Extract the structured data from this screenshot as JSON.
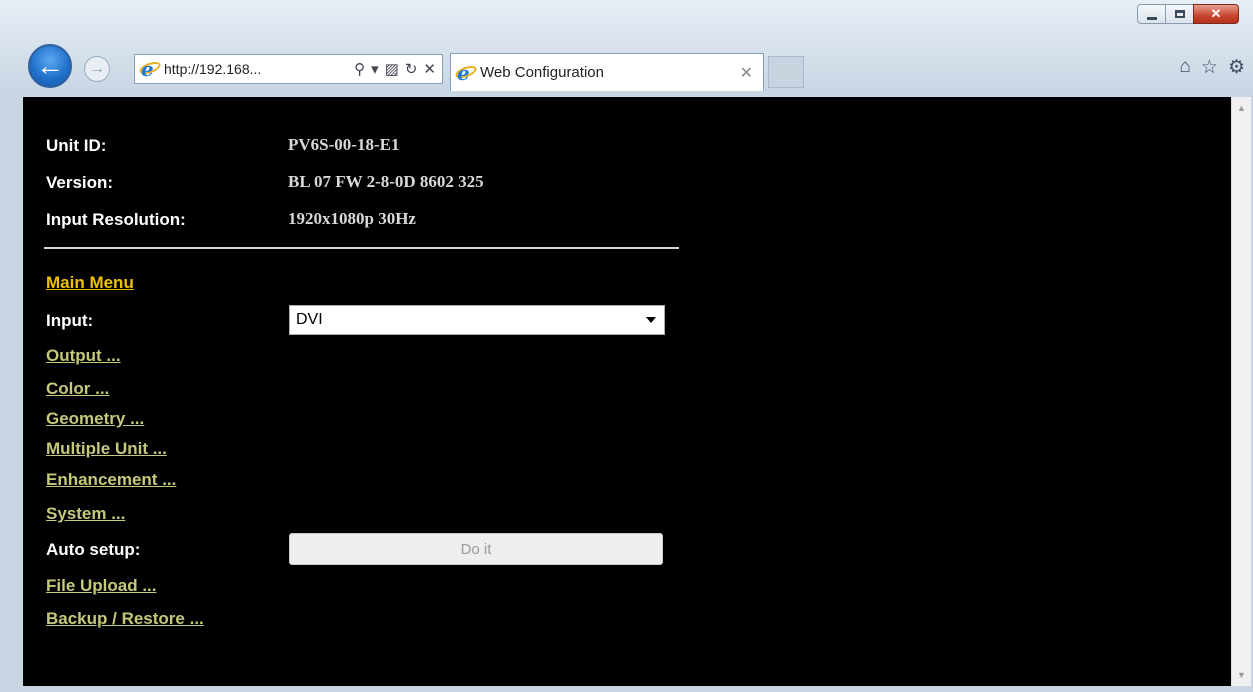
{
  "browser": {
    "address": "http://192.168...",
    "tab_title": "Web Configuration"
  },
  "unit": {
    "id_label": "Unit ID:",
    "id_value": "PV6S-00-18-E1",
    "version_label": "Version:",
    "version_value": "BL 07 FW 2-8-0D 8602 325",
    "resolution_label": "Input Resolution:",
    "resolution_value": "1920x1080p 30Hz"
  },
  "menu": {
    "main_menu": "Main Menu",
    "input_label": "Input:",
    "input_value": "DVI",
    "output": "Output ...",
    "color": "Color ...",
    "geometry": "Geometry ...",
    "multiple_unit": "Multiple Unit ...",
    "enhancement": "Enhancement ...",
    "system": "System ...",
    "auto_setup_label": "Auto setup:",
    "do_it": "Do it",
    "file_upload": "File Upload ...",
    "backup_restore": "Backup / Restore ..."
  },
  "colors": {
    "link": "#c5c77a",
    "main_link": "#f0c000",
    "background": "#000000"
  }
}
